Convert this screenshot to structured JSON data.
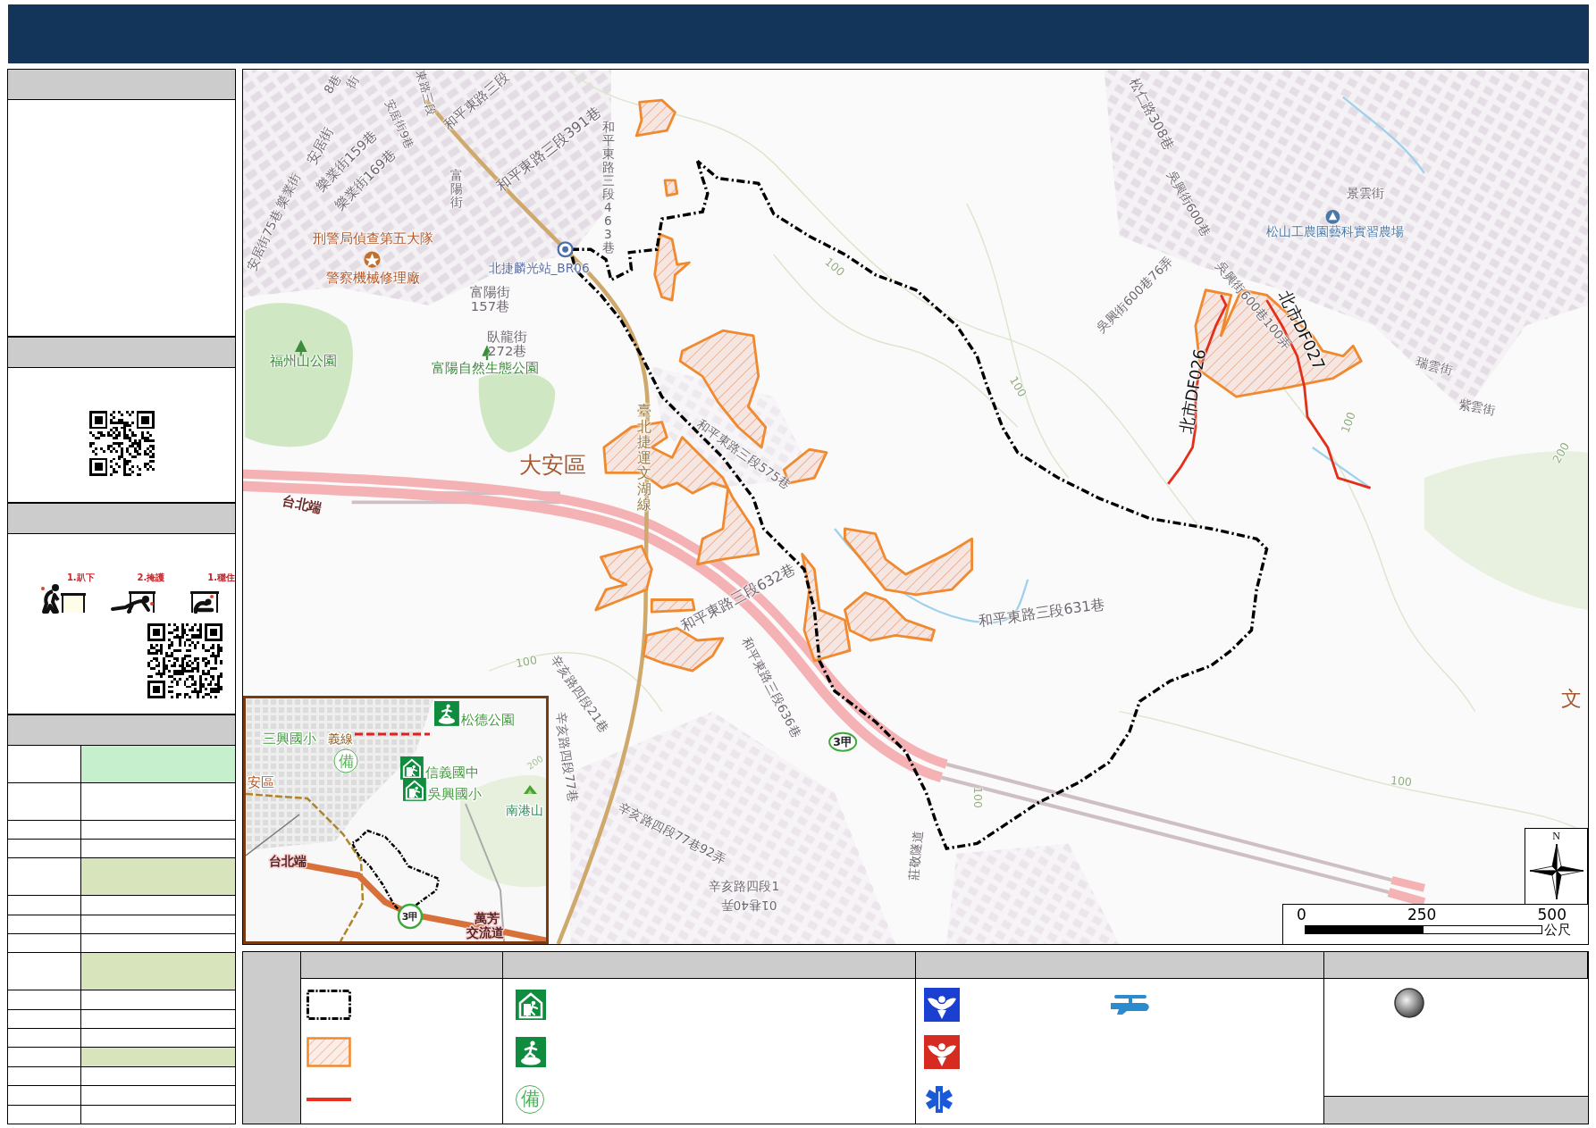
{
  "sidebar": {
    "sections": [
      {
        "kind": "blank"
      },
      {
        "kind": "qr"
      },
      {
        "kind": "safety",
        "steps": [
          {
            "label": "1.趴下",
            "kind": "drop"
          },
          {
            "label": "2.掩護",
            "kind": "cover"
          },
          {
            "label": "1.穩住",
            "kind": "hold"
          }
        ]
      },
      {
        "kind": "table",
        "rows": [
          {
            "kind": "tall",
            "color": "#c6efce"
          },
          {
            "kind": "tall"
          },
          {
            "kind": "short"
          },
          {
            "kind": "short"
          },
          {
            "kind": "tall",
            "color": "#d8e4bc"
          },
          {
            "kind": "short"
          },
          {
            "kind": "short"
          },
          {
            "kind": "short"
          },
          {
            "kind": "tall",
            "color": "#d8e4bc"
          },
          {
            "kind": "short"
          },
          {
            "kind": "short"
          },
          {
            "kind": "short"
          },
          {
            "kind": "short",
            "color": "#d8e4bc"
          },
          {
            "kind": "short"
          },
          {
            "kind": "short"
          },
          {
            "kind": "short"
          }
        ]
      }
    ]
  },
  "map": {
    "labels": [
      {
        "text": "8巷",
        "kind": "road"
      },
      {
        "text": "街",
        "kind": "road"
      },
      {
        "text": "東路三段",
        "kind": "road"
      },
      {
        "text": "和平東路三段",
        "kind": "road"
      },
      {
        "text": "安居街9巷",
        "kind": "road"
      },
      {
        "text": "安居街",
        "kind": "road"
      },
      {
        "text": "樂業街159巷",
        "kind": "road"
      },
      {
        "text": "樂業街169巷",
        "kind": "road"
      },
      {
        "text": "樂業街",
        "kind": "road"
      },
      {
        "text": "安居街75巷",
        "kind": "road"
      },
      {
        "text": "富陽街",
        "kind": "road_vertical"
      },
      {
        "text": "和平東路三段391巷",
        "kind": "road"
      },
      {
        "text": "和平東路三段463巷",
        "kind": "road_vertical"
      },
      {
        "text": "刑警局偵查第五大隊",
        "kind": "poi"
      },
      {
        "text": "警察機械修理廠",
        "kind": "poi"
      },
      {
        "text": "北捷麟光站_BR06",
        "kind": "station"
      },
      {
        "lines": [
          "富陽街",
          "157巷"
        ],
        "kind": "road"
      },
      {
        "lines": [
          "臥龍街",
          "272巷"
        ],
        "kind": "road"
      },
      {
        "text": "富陽自然生態公園",
        "kind": "park"
      },
      {
        "text": "福州山公園",
        "kind": "park"
      },
      {
        "text": "大安區",
        "kind": "district"
      },
      {
        "text": "台北端",
        "kind": "interchange"
      },
      {
        "text": "臺北捷運文湖線",
        "kind": "metro_line"
      },
      {
        "text": "和平東路三段575巷",
        "kind": "road"
      },
      {
        "text": "和平東路三段632巷",
        "kind": "road"
      },
      {
        "text": "和平東路三段631巷",
        "kind": "road"
      },
      {
        "text": "辛亥路四段21巷",
        "kind": "road"
      },
      {
        "text": "辛亥路四段77巷",
        "kind": "road"
      },
      {
        "text": "辛亥路四段77巷92弄",
        "kind": "road"
      },
      {
        "text": "辛亥路四段1",
        "kind": "road"
      },
      {
        "text": "01巷40弄",
        "kind": "road"
      },
      {
        "text": "和平東路三段636巷",
        "kind": "road"
      },
      {
        "text": "松仁路308巷",
        "kind": "road"
      },
      {
        "text": "吳興街600巷",
        "kind": "road"
      },
      {
        "text": "景雲街",
        "kind": "road"
      },
      {
        "text": "松山工農園藝科實習農場",
        "kind": "school"
      },
      {
        "text": "吳興街600巷76弄",
        "kind": "road"
      },
      {
        "text": "吳興街600巷100弄",
        "kind": "road"
      },
      {
        "text": "瑞雲街",
        "kind": "road"
      },
      {
        "text": "紫雲街",
        "kind": "road"
      },
      {
        "text": "莊敬隧道",
        "kind": "road"
      },
      {
        "text": "北市DF026",
        "kind": "debris_flow"
      },
      {
        "text": "北市DF027",
        "kind": "debris_flow"
      },
      {
        "text": "100",
        "kind": "contour"
      },
      {
        "text": "100",
        "kind": "contour"
      },
      {
        "text": "100",
        "kind": "contour"
      },
      {
        "text": "100",
        "kind": "contour"
      },
      {
        "text": "100",
        "kind": "contour"
      },
      {
        "text": "100",
        "kind": "contour"
      },
      {
        "text": "200",
        "kind": "contour"
      },
      {
        "text": "3甲",
        "kind": "shield"
      },
      {
        "text": "文",
        "kind": "district"
      }
    ],
    "inset": {
      "labels": [
        {
          "text": "松德公園",
          "kind": "refuge"
        },
        {
          "text": "三興國小",
          "kind": "school"
        },
        {
          "text": "義線",
          "kind": "line"
        },
        {
          "text": "備",
          "kind": "symbol"
        },
        {
          "text": "信義國中",
          "kind": "shelter"
        },
        {
          "text": "吳興國小",
          "kind": "shelter"
        },
        {
          "text": "安區",
          "kind": "district"
        },
        {
          "text": "200",
          "kind": "contour"
        },
        {
          "text": "南港山",
          "kind": "mountain"
        },
        {
          "text": "台北端",
          "kind": "interchange"
        },
        {
          "text": "3甲",
          "kind": "shield"
        },
        {
          "text": "萬芳",
          "kind": "interchange"
        },
        {
          "text": "交流道",
          "kind": "interchange"
        }
      ]
    },
    "north": "N",
    "scale": {
      "ticks": [
        "0",
        "250",
        "500"
      ],
      "unit": "公尺"
    }
  },
  "legend": {
    "columns": [
      {
        "items": [
          {
            "kind": "boundary"
          },
          {
            "kind": "hazard_area"
          },
          {
            "kind": "debris_flow"
          }
        ]
      },
      {
        "items": [
          {
            "kind": "shelter"
          },
          {
            "kind": "refuge"
          },
          {
            "kind": "standby",
            "symbol": "備"
          }
        ]
      },
      {
        "items": [
          {
            "kind": "police"
          },
          {
            "kind": "fire"
          },
          {
            "kind": "ems"
          },
          {
            "kind": "helipad"
          }
        ]
      },
      {
        "items": [
          {
            "kind": "sphere"
          }
        ],
        "footer": true
      }
    ]
  }
}
